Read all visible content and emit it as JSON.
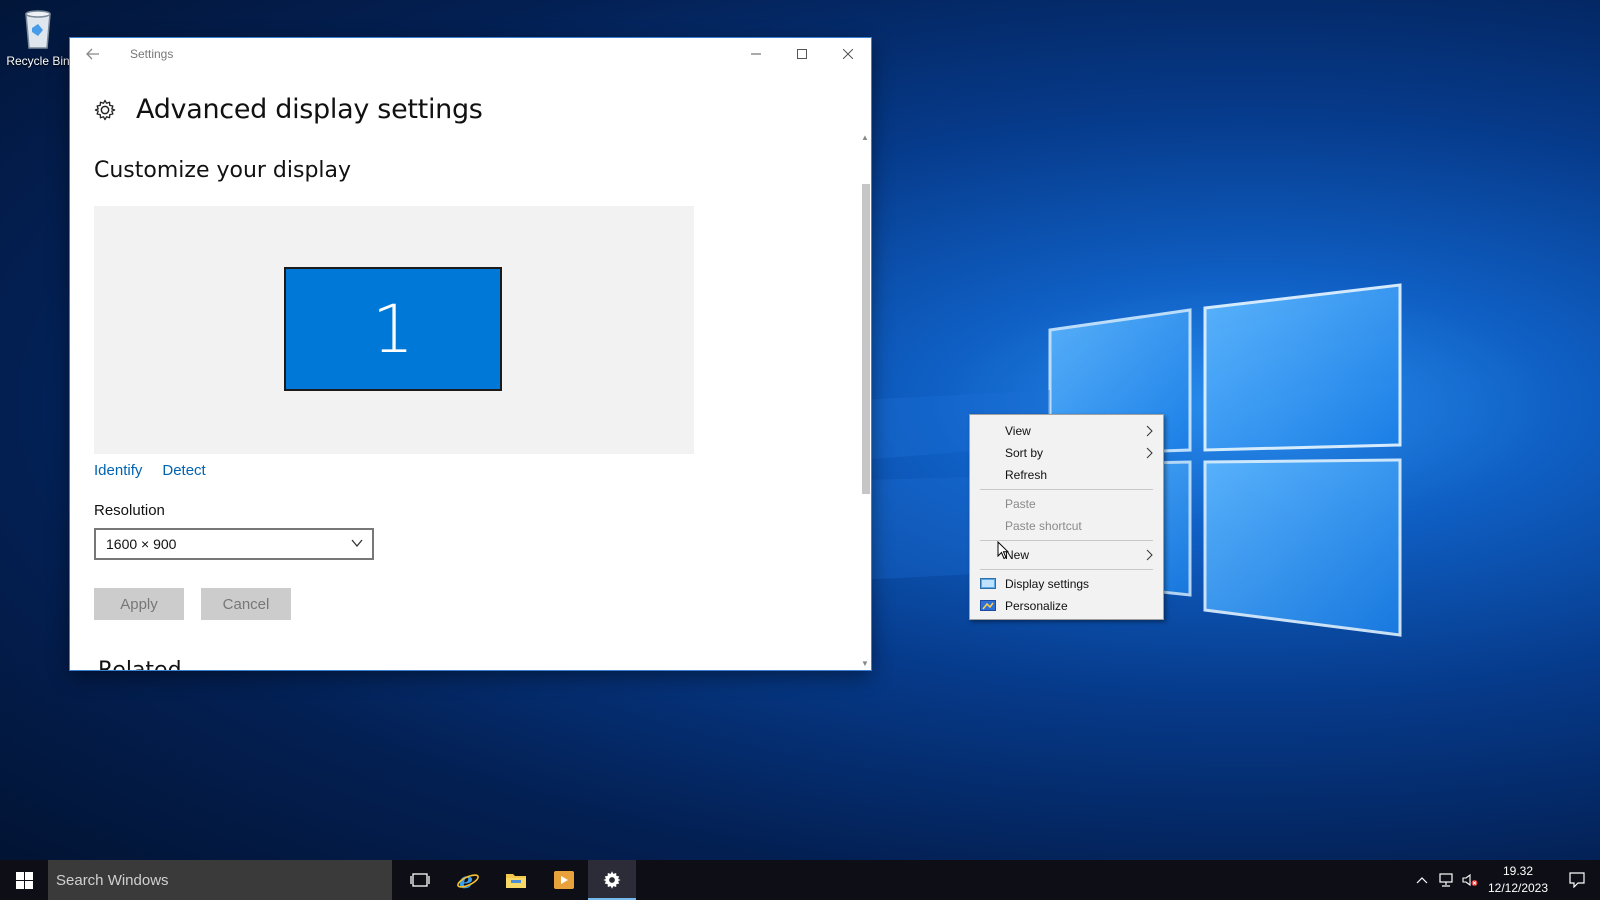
{
  "desktop": {
    "icons": [
      {
        "label": "Recycle Bin",
        "icon": "recycle-bin-icon"
      }
    ]
  },
  "settings_window": {
    "title": "Settings",
    "page_title": "Advanced display settings",
    "section_title": "Customize your display",
    "monitor_number": "1",
    "links": {
      "identify": "Identify",
      "detect": "Detect"
    },
    "resolution": {
      "label": "Resolution",
      "value": "1600 × 900"
    },
    "buttons": {
      "apply": "Apply",
      "cancel": "Cancel"
    },
    "next_section_cut": "Related settings"
  },
  "context_menu": {
    "items": [
      {
        "label": "View",
        "submenu": true,
        "enabled": true
      },
      {
        "label": "Sort by",
        "submenu": true,
        "enabled": true
      },
      {
        "label": "Refresh",
        "submenu": false,
        "enabled": true
      },
      {
        "label": "Paste",
        "submenu": false,
        "enabled": false
      },
      {
        "label": "Paste shortcut",
        "submenu": false,
        "enabled": false
      },
      {
        "label": "New",
        "submenu": true,
        "enabled": true
      },
      {
        "label": "Display settings",
        "icon": "display-settings-icon",
        "enabled": true
      },
      {
        "label": "Personalize",
        "icon": "personalize-icon",
        "enabled": true
      }
    ]
  },
  "taskbar": {
    "search_placeholder": "Search Windows",
    "pinned": [
      "task-view-icon",
      "internet-explorer-icon",
      "file-explorer-icon",
      "media-player-icon",
      "settings-icon"
    ],
    "active_app": "settings-icon",
    "clock": {
      "time": "19.32",
      "date": "12/12/2023"
    }
  },
  "colors": {
    "accent": "#0078d7",
    "link": "#0063b1",
    "taskbar": "#0e0e16"
  }
}
